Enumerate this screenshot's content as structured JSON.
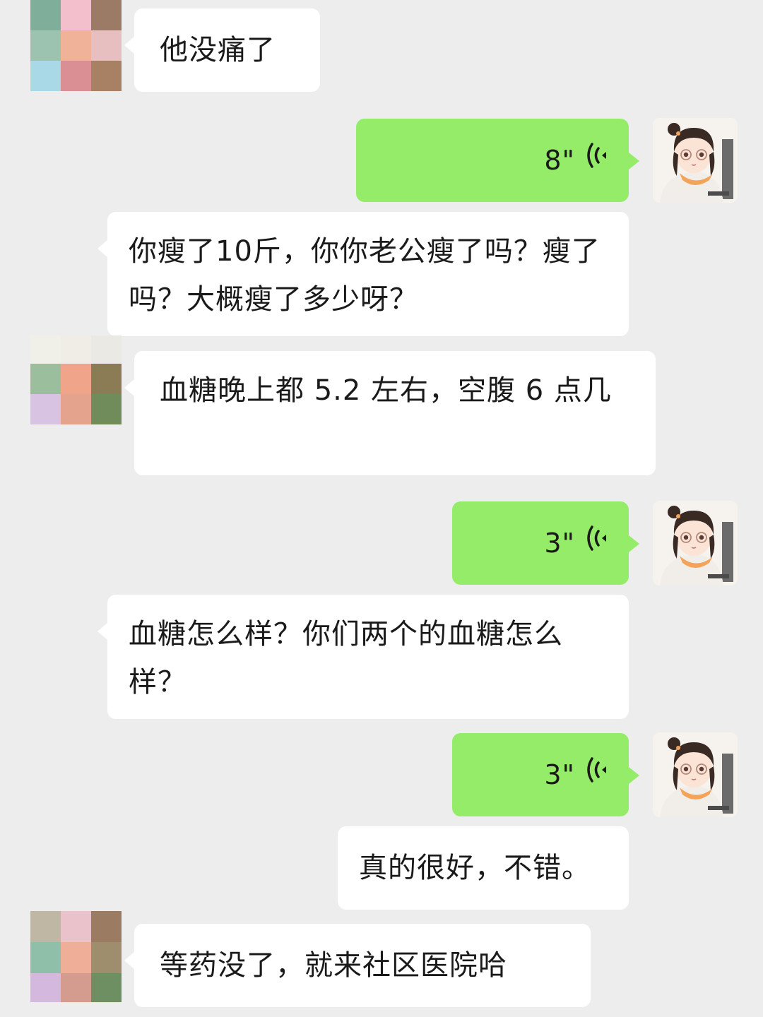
{
  "messages": [
    {
      "side": "in",
      "type": "text",
      "text": "他没痛了"
    },
    {
      "side": "out",
      "type": "voice",
      "duration": "8\""
    },
    {
      "side": "in",
      "type": "text",
      "text": "你瘦了10斤，你你老公瘦了吗？瘦了吗？大概瘦了多少呀？"
    },
    {
      "side": "in",
      "type": "text",
      "text": "血糖晚上都 5.2 左右，空腹 6 点几"
    },
    {
      "side": "out",
      "type": "voice",
      "duration": "3\""
    },
    {
      "side": "in",
      "type": "text",
      "text": "血糖怎么样？你们两个的血糖怎么样？"
    },
    {
      "side": "out",
      "type": "voice",
      "duration": "3\""
    },
    {
      "side": "in",
      "type": "text",
      "text": "真的很好，不错。"
    },
    {
      "side": "in",
      "type": "text",
      "text": "等药没了，就来社区医院哈"
    }
  ],
  "colors": {
    "background": "#ededed",
    "incoming_bubble": "#ffffff",
    "outgoing_bubble": "#95ec69"
  },
  "icons": {
    "voice": "voice-wave-icon",
    "contact_avatar": "pixelated-avatar",
    "my_avatar": "cartoon-girl-avatar"
  }
}
